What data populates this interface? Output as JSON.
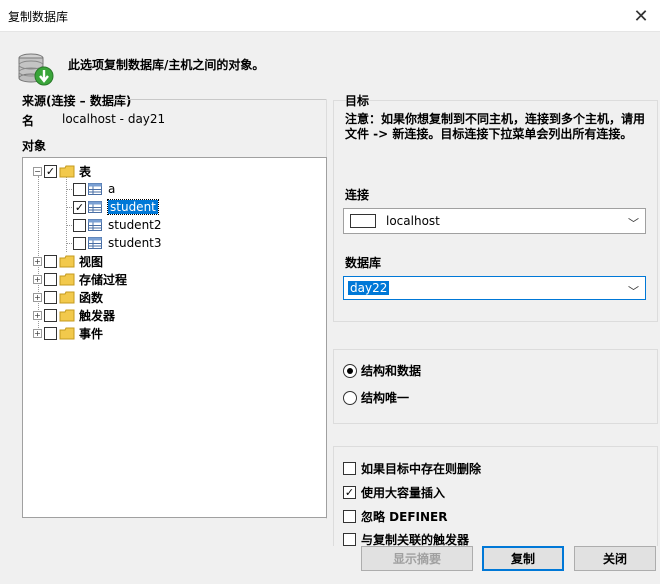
{
  "window": {
    "title": "复制数据库"
  },
  "intro": "此选项复制数据库/主机之间的对象。",
  "source": {
    "group_label": "来源(连接 – 数据库)",
    "name_label": "名",
    "name_value": "localhost - day21",
    "objects_label": "对象"
  },
  "tree": {
    "tables": {
      "label": "表",
      "checked": true,
      "items": [
        {
          "label": "a",
          "checked": false
        },
        {
          "label": "student",
          "checked": true,
          "selected": true
        },
        {
          "label": "student2",
          "checked": false
        },
        {
          "label": "student3",
          "checked": false
        }
      ]
    },
    "others": [
      {
        "label": "视图"
      },
      {
        "label": "存储过程"
      },
      {
        "label": "函数"
      },
      {
        "label": "触发器"
      },
      {
        "label": "事件"
      }
    ]
  },
  "target": {
    "group_label": "目标",
    "note": "注意：如果你想复制到不同主机，连接到多个主机，请用文件 -> 新连接。目标连接下拉菜单会列出所有连接。",
    "connection_label": "连接",
    "connection_value": "localhost",
    "database_label": "数据库",
    "database_value": "day22"
  },
  "mode": {
    "structure_and_data": "结构和数据",
    "structure_only": "结构唯一",
    "selected": "structure_and_data"
  },
  "options": [
    {
      "label": "如果目标中存在则删除",
      "checked": false
    },
    {
      "label": "使用大容量插入",
      "checked": true
    },
    {
      "label": "忽略 DEFINER",
      "checked": false
    },
    {
      "label": "与复制关联的触发器",
      "checked": false
    }
  ],
  "buttons": {
    "summary": "显示摘要",
    "copy": "复制",
    "close": "关闭"
  },
  "icons": {
    "close": "close-icon",
    "database": "database-download-icon",
    "folder": "folder-icon",
    "table": "table-icon"
  }
}
